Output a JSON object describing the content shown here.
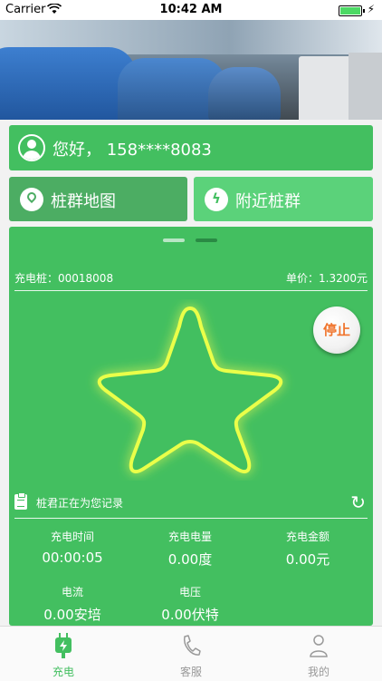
{
  "status_bar": {
    "carrier": "Carrier",
    "time": "10:42 AM"
  },
  "banner": {
    "page_count": 1
  },
  "greeting": {
    "text": "您好，  158****8083"
  },
  "nav": {
    "map_label": "桩群地图",
    "nearby_label": "附近桩群"
  },
  "panel": {
    "pile_label": "充电桩：00018008",
    "price_label": "单价：1.3200元",
    "stop_label": "停止",
    "record_label": "桩君正在为您记录",
    "stats": [
      {
        "key": "充电时间",
        "value": "00:00:05"
      },
      {
        "key": "充电电量",
        "value": "0.00度"
      },
      {
        "key": "充电金额",
        "value": "0.00元"
      },
      {
        "key": "电流",
        "value": "0.00安培"
      },
      {
        "key": "电压",
        "value": "0.00伏特"
      }
    ]
  },
  "tabs": [
    {
      "label": "充电",
      "active": true,
      "icon": "charger-icon"
    },
    {
      "label": "客服",
      "active": false,
      "icon": "phone-icon"
    },
    {
      "label": "我的",
      "active": false,
      "icon": "user-icon"
    }
  ],
  "colors": {
    "primary": "#43bf60",
    "stop_text": "#f0742c",
    "star_glow": "#f3ff54"
  }
}
